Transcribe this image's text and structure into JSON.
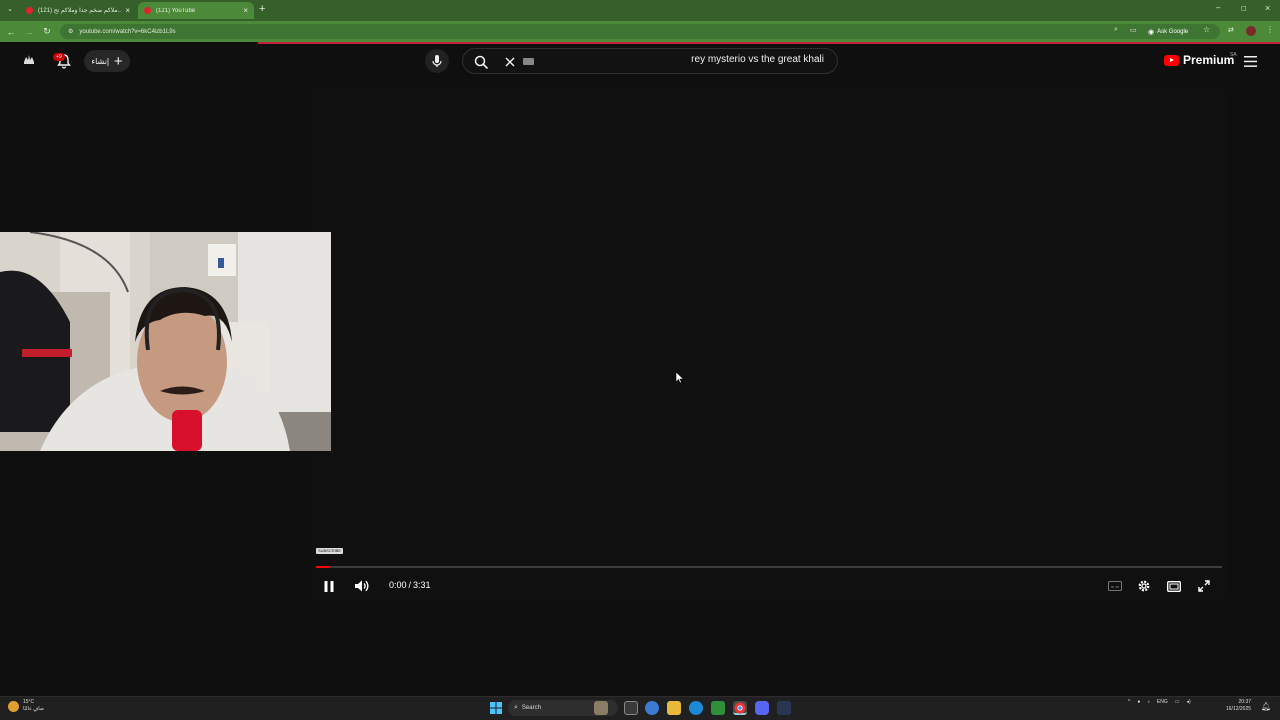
{
  "browser": {
    "tabs": [
      {
        "title": "(121) ملاكم ضخم جدا وملاكم تح..."
      },
      {
        "title": "(121) YouTube"
      }
    ],
    "url": "youtube.com/watch?v=6kC4izb1L9s",
    "ask_google": "Ask Google"
  },
  "youtube": {
    "notification_count": "+9",
    "create_label": "إنشاء",
    "search_query": "rey mysterio vs the great khali",
    "premium_label": "Premium",
    "country_code": "SA"
  },
  "player": {
    "subscribe_tag": "SUBSCRIBE",
    "current_time": "0:00",
    "separator": "/",
    "duration": "3:31",
    "progress_fraction": 0.016,
    "state": "playing"
  },
  "taskbar": {
    "weather_temp": "15°C",
    "weather_desc": "صافٍ غالبًا",
    "search_label": "Search",
    "language": "ENG",
    "time": "20:37",
    "date": "16/12/2025"
  },
  "colors": {
    "browser_frame": "#35602a",
    "browser_toolbar": "#4c8a3a",
    "youtube_bg": "#0f0f0f",
    "youtube_red": "#ff0000"
  },
  "icons": [
    "avatar-icon",
    "bell-icon",
    "plus-icon",
    "mic-icon",
    "search-icon",
    "clear-icon",
    "keyboard-icon",
    "youtube-logo-icon",
    "menu-icon",
    "pause-icon",
    "volume-icon",
    "captions-icon",
    "settings-icon",
    "theater-icon",
    "fullscreen-icon"
  ]
}
